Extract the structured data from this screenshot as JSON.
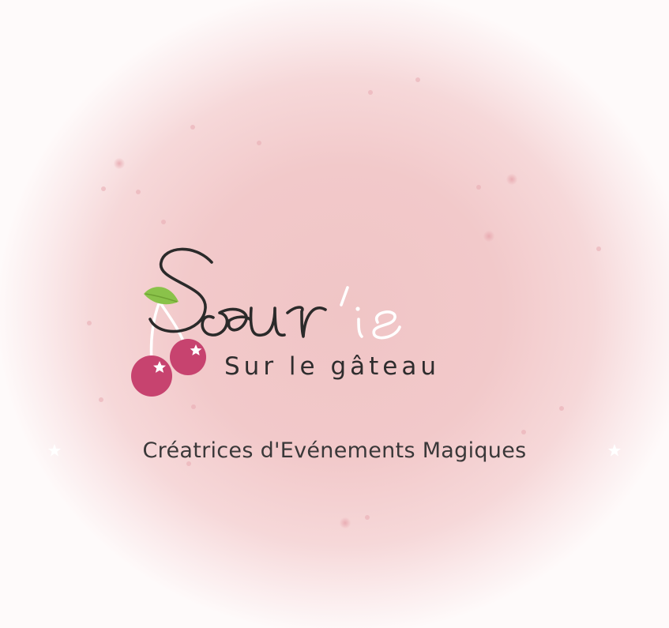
{
  "brand": {
    "name_dark": "Sœur",
    "name_light": "'is",
    "subtitle": "Sur le gâteau",
    "tagline": "Créatrices d'Evénements Magiques"
  },
  "colors": {
    "background_center": "#f0c5c6",
    "background_edge": "#ffffff",
    "script_dark": "#2b2a2a",
    "script_light": "#ffffff",
    "cherry": "#c7436f",
    "leaf": "#8ac24a",
    "sparkle": "#e7a9b0"
  },
  "icons": {
    "logo": "cherries-icon",
    "tagline_left": "star-icon",
    "tagline_right": "star-icon"
  }
}
